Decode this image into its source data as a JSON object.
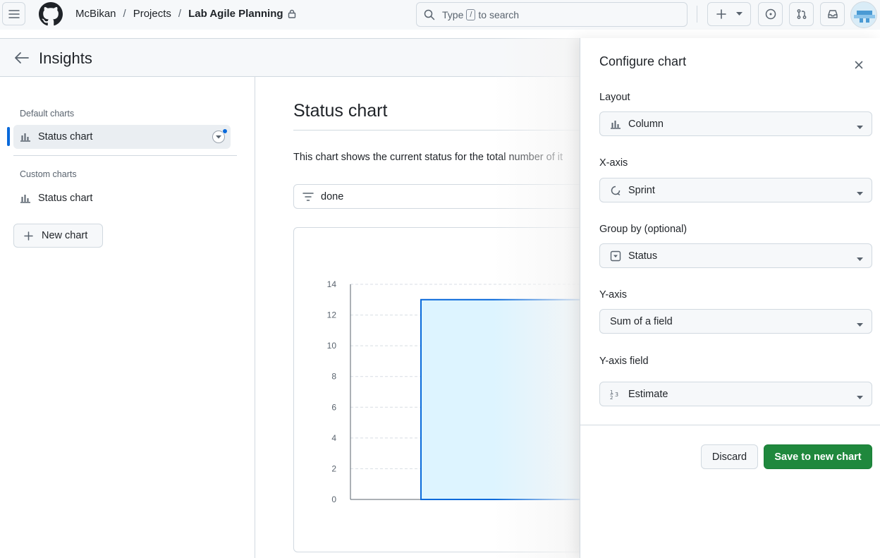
{
  "header": {
    "owner": "McBikan",
    "projects": "Projects",
    "project_name": "Lab Agile Planning",
    "search_prefix": "Type",
    "search_key": "/",
    "search_suffix": "to search"
  },
  "page": {
    "title": "Insights"
  },
  "sidebar": {
    "default_heading": "Default charts",
    "default_item": "Status chart",
    "custom_heading": "Custom charts",
    "custom_item": "Status chart",
    "new_chart": "New chart"
  },
  "main": {
    "title": "Status chart",
    "description": "This chart shows the current status for the total number of it",
    "filter": "done"
  },
  "chart_data": {
    "type": "bar",
    "categories": [
      ""
    ],
    "values": [
      13
    ],
    "ylim": [
      0,
      14
    ],
    "yticks": [
      "0",
      "2",
      "4",
      "6",
      "8",
      "10",
      "12",
      "14"
    ],
    "grid": true,
    "colors": {
      "fill": "#ddf4ff",
      "stroke": "#0969da"
    }
  },
  "config": {
    "title": "Configure chart",
    "layout_label": "Layout",
    "layout_value": "Column",
    "xaxis_label": "X-axis",
    "xaxis_value": "Sprint",
    "groupby_label": "Group by (optional)",
    "groupby_value": "Status",
    "yaxis_label": "Y-axis",
    "yaxis_value": "Sum of a field",
    "yfield_label": "Y-axis field",
    "yfield_value": "Estimate",
    "discard": "Discard",
    "save": "Save to new chart"
  },
  "colors": {
    "accent": "#0969da",
    "primary_button": "#1f883d"
  },
  "icons": [
    "hamburger-icon",
    "github-logo-icon",
    "lock-icon",
    "search-icon",
    "plus-icon",
    "issue-icon",
    "pull-request-icon",
    "inbox-icon",
    "arrow-left-icon",
    "bar-chart-icon",
    "filter-icon",
    "close-icon",
    "iteration-icon",
    "single-select-icon",
    "number-icon",
    "chevron-down-icon"
  ]
}
